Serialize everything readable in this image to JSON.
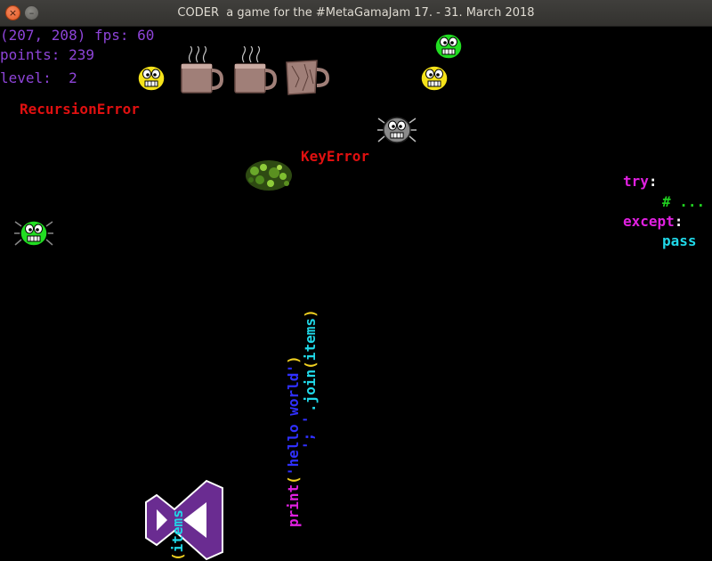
{
  "window": {
    "title": "CODER  a game for the #MetaGamaJam 17. - 31. March 2018",
    "close_glyph": "×",
    "minimize_glyph": "–"
  },
  "hud": {
    "coords_fps": "(207, 208) fps: 60",
    "points": "points: 239",
    "level": "level:  2"
  },
  "errors": {
    "recursion": "RecursionError",
    "key": "KeyError"
  },
  "code_block": {
    "try_kw": "try",
    "colon": ":",
    "comment": "# ...",
    "except_kw": "except",
    "pass_kw": "pass"
  },
  "vertical_code": {
    "print_kw": "print",
    "open_paren": "(",
    "hello_str": "'hello world'",
    "close_paren": ")",
    "join_quote": "'; '",
    "join_call": ".join",
    "join_open": "(",
    "items": "items",
    "join_close": ")",
    "bottom_paren": "(",
    "bottom_items": "items"
  },
  "sprites": {
    "enemy_icon": "bug-icon",
    "coffee_icon": "coffee-mug-icon",
    "player_icon": "visual-studio-logo-icon",
    "explosion_icon": "green-splat-icon"
  },
  "colors": {
    "background": "#000000",
    "hud": "#8e44d8",
    "error": "#e01010",
    "keyword": "#e020e0",
    "comment": "#20d020",
    "name": "#20d8e8",
    "string": "#3030ff",
    "enemy_green": "#22dd22",
    "enemy_yellow": "#f5e21a",
    "enemy_gray": "#8a8a8a",
    "player_purple": "#6a2c91"
  }
}
